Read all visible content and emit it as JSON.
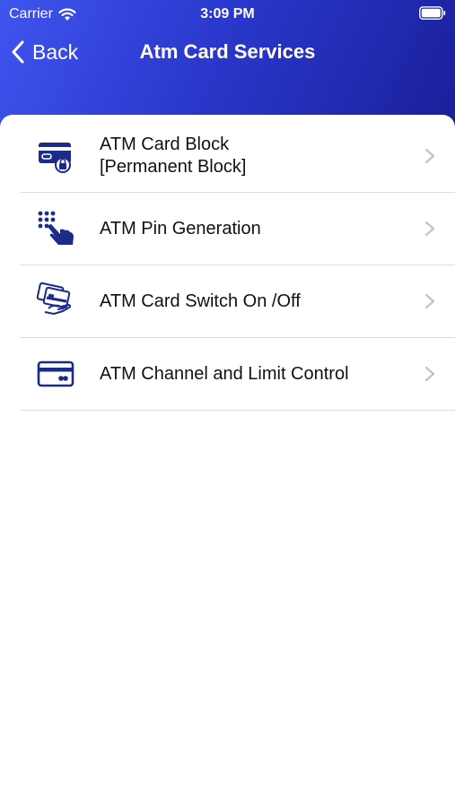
{
  "status_bar": {
    "carrier": "Carrier",
    "time": "3:09 PM"
  },
  "nav": {
    "back_label": "Back",
    "title": "Atm Card Services"
  },
  "menu": {
    "items": [
      {
        "line1": "ATM Card Block",
        "line2": "[Permanent Block]",
        "icon": "card-lock-icon"
      },
      {
        "line1": "ATM Pin Generation",
        "line2": "",
        "icon": "keypad-touch-icon"
      },
      {
        "line1": "ATM Card Switch On /Off",
        "line2": "",
        "icon": "card-in-hand-icon"
      },
      {
        "line1": "ATM Channel and Limit Control",
        "line2": "",
        "icon": "card-icon"
      }
    ]
  },
  "colors": {
    "header_gradient_start": "#3f55ef",
    "header_gradient_end": "#1a1f9a",
    "icon_navy": "#1c2a8a",
    "chevron": "#c4c4c8"
  }
}
